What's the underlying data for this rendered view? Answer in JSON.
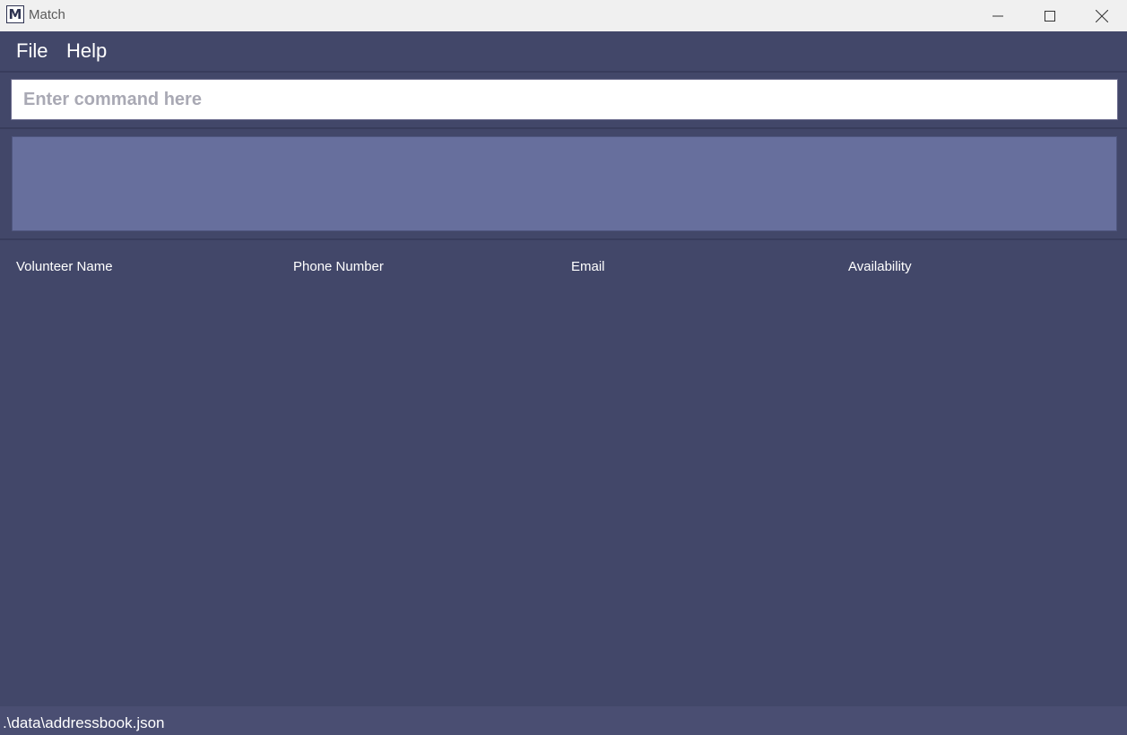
{
  "window": {
    "title": "Match",
    "icon": "match-app-icon",
    "controls": {
      "minimize": "minimize-icon",
      "maximize": "maximize-icon",
      "close": "close-icon"
    }
  },
  "menu": {
    "file_label": "File",
    "help_label": "Help"
  },
  "command": {
    "placeholder": "Enter command here",
    "value": ""
  },
  "result": {
    "text": ""
  },
  "table": {
    "columns": [
      "Volunteer Name",
      "Phone Number",
      "Email",
      "Availability"
    ],
    "rows": []
  },
  "status": {
    "file_path": ".\\data\\addressbook.json"
  },
  "colors": {
    "background": "#424769",
    "result_panel": "#676f9d",
    "status_bar": "#4a4e72",
    "title_bar": "#f0f0f0"
  }
}
